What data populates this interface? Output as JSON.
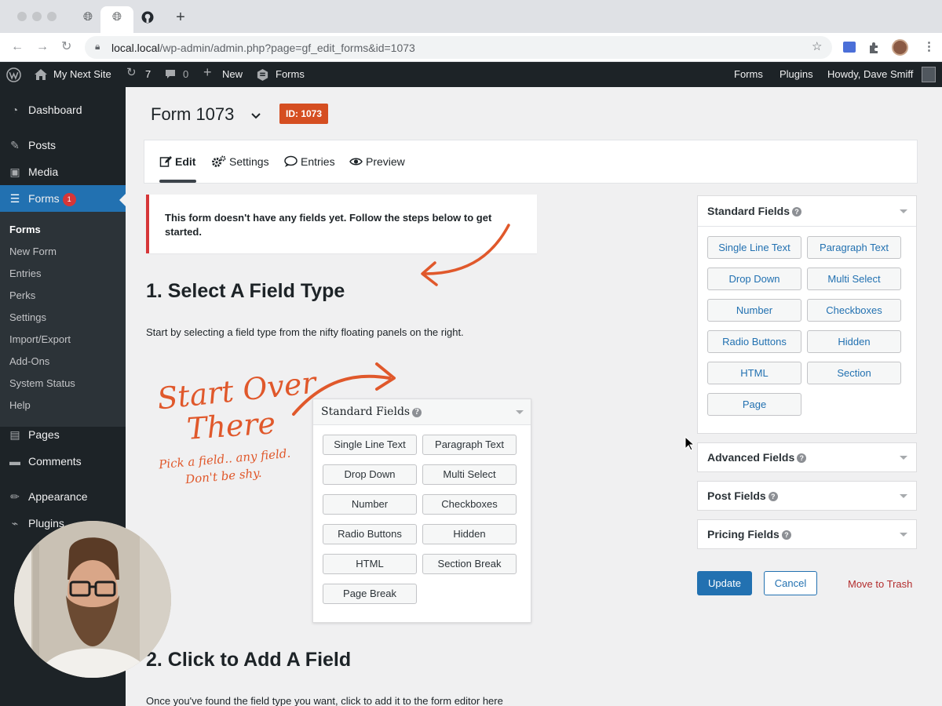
{
  "browser": {
    "url_host": "local.local",
    "url_path": "/wp-admin/admin.php?page=gf_edit_forms&id=1073",
    "new_tab_label": "+"
  },
  "admin_bar": {
    "site_name": "My Next Site",
    "updates_count": "7",
    "comments_count": "0",
    "new_label": "New",
    "forms_label": "Forms",
    "right_forms": "Forms",
    "right_plugins": "Plugins",
    "howdy": "Howdy, Dave Smiff"
  },
  "sidebar": {
    "dashboard": "Dashboard",
    "posts": "Posts",
    "media": "Media",
    "forms": "Forms",
    "forms_badge": "1",
    "submenu": [
      "Forms",
      "New Form",
      "Entries",
      "Perks",
      "Settings",
      "Import/Export",
      "Add-Ons",
      "System Status",
      "Help"
    ],
    "pages": "Pages",
    "comments": "Comments",
    "appearance": "Appearance",
    "plugins": "Plugins"
  },
  "form": {
    "title": "Form 1073",
    "id_badge": "ID: 1073"
  },
  "tabs": {
    "edit": "Edit",
    "settings": "Settings",
    "entries": "Entries",
    "preview": "Preview"
  },
  "notice": "This form doesn't have any fields yet. Follow the steps below to get started.",
  "step1": {
    "heading": "1. Select A Field Type",
    "text": "Start by selecting a field type from the nifty floating panels on the right."
  },
  "step2": {
    "heading": "2. Click to Add A Field",
    "text": "Once you've found the field type you want, click to add it to the form editor here"
  },
  "illustration": {
    "panel_title": "Standard Fields",
    "buttons": [
      "Single Line Text",
      "Paragraph Text",
      "Drop Down",
      "Multi Select",
      "Number",
      "Checkboxes",
      "Radio Buttons",
      "Hidden",
      "HTML",
      "Section Break",
      "Page Break"
    ],
    "hand_line1": "Start Over",
    "hand_line2": "There",
    "hand_line3": "Pick a field.. any field.",
    "hand_line4": "Don't be shy."
  },
  "right_panels": {
    "standard_title": "Standard Fields",
    "standard_buttons": [
      "Single Line Text",
      "Paragraph Text",
      "Drop Down",
      "Multi Select",
      "Number",
      "Checkboxes",
      "Radio Buttons",
      "Hidden",
      "HTML",
      "Section",
      "Page"
    ],
    "advanced_title": "Advanced Fields",
    "post_title": "Post Fields",
    "pricing_title": "Pricing Fields"
  },
  "actions": {
    "update": "Update",
    "cancel": "Cancel",
    "trash": "Move to Trash"
  },
  "help_glyph": "?",
  "colors": {
    "wp_blue": "#2271b1",
    "admin_dark": "#1d2327",
    "notice_red": "#d63638",
    "id_badge": "#d54e21",
    "handwriting": "#e0582b"
  }
}
